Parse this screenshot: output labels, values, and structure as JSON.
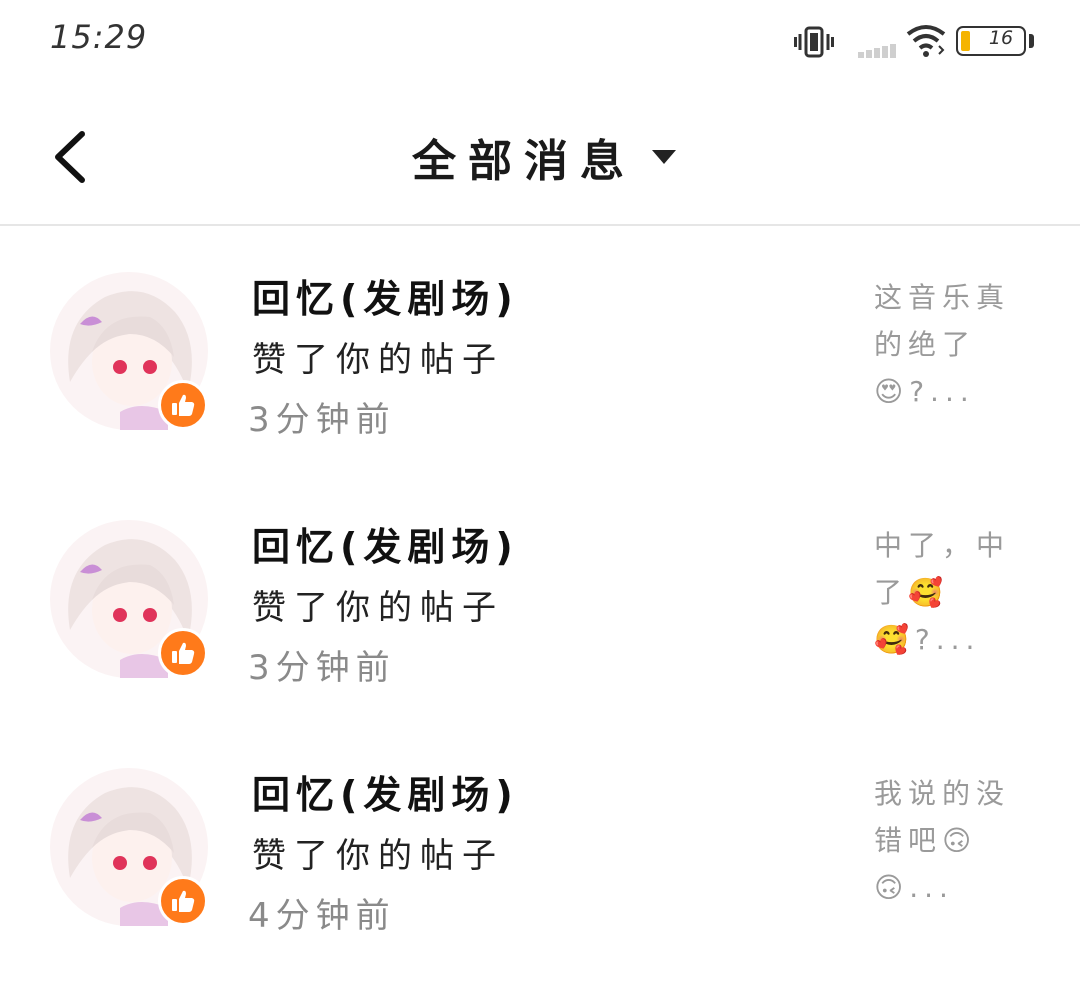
{
  "status_bar": {
    "time": "15:29",
    "battery_level": "16",
    "battery_color": "#f5b400"
  },
  "header": {
    "title": "全部消息",
    "back_icon": "chevron-left-icon",
    "dropdown_icon": "triangle-down-icon"
  },
  "messages": [
    {
      "sender": "回忆(发剧场)",
      "action": "赞了你的帖子",
      "time": "3分钟前",
      "preview": "这音乐真的绝了😍?...",
      "badge_icon": "thumbs-up-icon"
    },
    {
      "sender": "回忆(发剧场)",
      "action": "赞了你的帖子",
      "time": "3分钟前",
      "preview": "中了，中了🥰🥰?...",
      "badge_icon": "thumbs-up-icon"
    },
    {
      "sender": "回忆(发剧场)",
      "action": "赞了你的帖子",
      "time": "4分钟前",
      "preview": "我说的没错吧🙃🙃...",
      "badge_icon": "thumbs-up-icon"
    }
  ],
  "colors": {
    "accent": "#ff7a1a",
    "secondary_text": "#8a8a8a",
    "preview_text": "#9a9a9a"
  }
}
